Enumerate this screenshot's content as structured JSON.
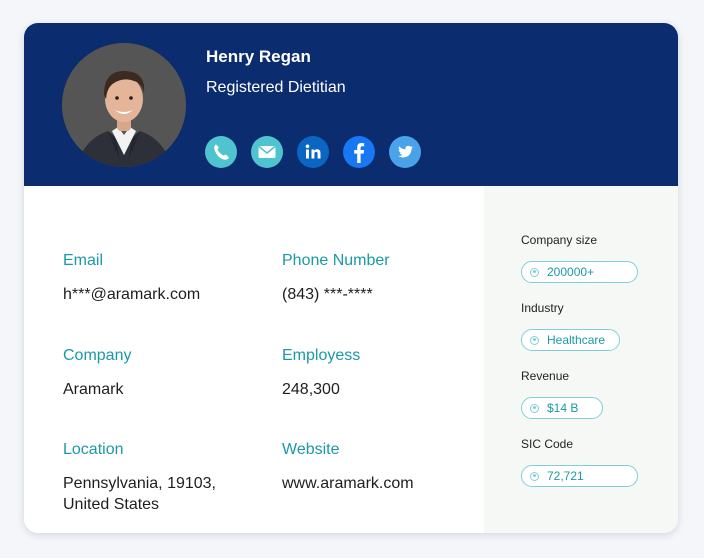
{
  "profile": {
    "name": "Henry Regan",
    "title": "Registered Dietitian",
    "avatar_icon": "person-photo-icon"
  },
  "socials": [
    {
      "name": "phone-icon",
      "color": "#4fc3d0"
    },
    {
      "name": "email-icon",
      "color": "#4fc3d0"
    },
    {
      "name": "linkedin-icon",
      "color": "#0a66c2"
    },
    {
      "name": "facebook-icon",
      "color": "#1877f2"
    },
    {
      "name": "twitter-icon",
      "color": "#4aa3e8"
    }
  ],
  "details": {
    "email": {
      "label": "Email",
      "value": "h***@aramark.com"
    },
    "phone": {
      "label": "Phone Number",
      "value": "(843) ***-****"
    },
    "company": {
      "label": "Company",
      "value": "Aramark"
    },
    "employees": {
      "label": "Employess",
      "value": "248,300"
    },
    "location": {
      "label": "Location",
      "value": "Pennsylvania, 19103,\nUnited States"
    },
    "website": {
      "label": "Website",
      "value": "www.aramark.com"
    }
  },
  "side": {
    "company_size": {
      "label": "Company size",
      "value": "200000+"
    },
    "industry": {
      "label": "Industry",
      "value": "Healthcare"
    },
    "revenue": {
      "label": "Revenue",
      "value": "$14 B"
    },
    "sic_code": {
      "label": "SIC Code",
      "value": "72,721"
    }
  },
  "colors": {
    "header_bg": "#0b2c6f",
    "accent": "#1a9aa6",
    "pill_border": "#7fd0d8",
    "side_bg": "#f6f8f6"
  }
}
